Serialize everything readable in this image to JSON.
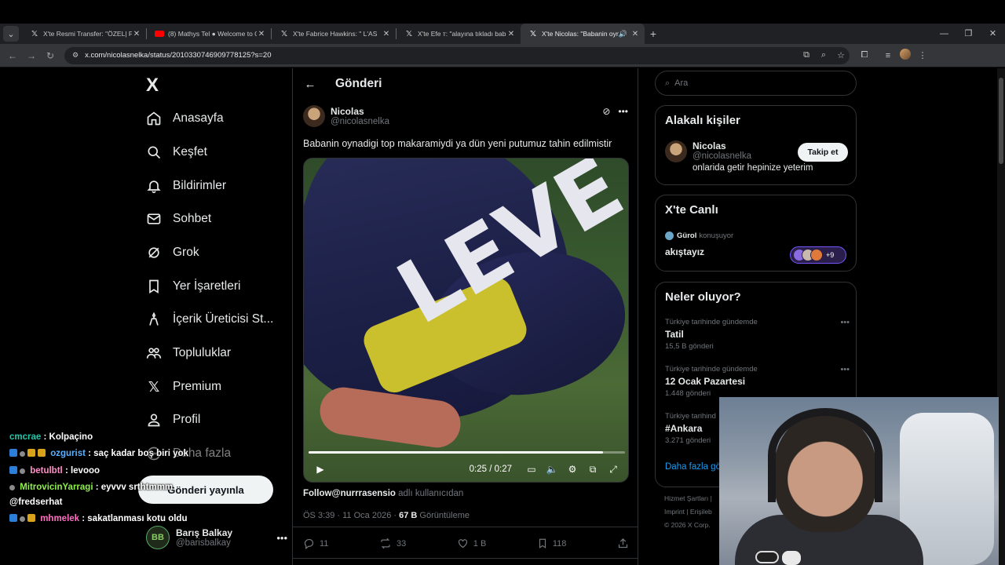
{
  "browser": {
    "tabs": [
      {
        "label": "X'te Resmi Transfer: \"ÖZEL| Fen",
        "favicon": "x-logo",
        "active": false
      },
      {
        "label": "(8) Mathys Tel ● Welcome to G",
        "favicon": "youtube-logo",
        "active": false
      },
      {
        "label": "X'te Fabrice Hawkins: \" L'AS",
        "favicon": "x-logo",
        "active": false
      },
      {
        "label": "X'te Efe т: \"alayına tıkladı bab",
        "favicon": "x-logo",
        "active": false
      },
      {
        "label": "X'te Nicolas: \"Babanin oyna",
        "favicon": "x-logo",
        "active": true
      }
    ],
    "url": "x.com/nicolasnelka/status/2010330746909778125?s=20",
    "window_controls": [
      "—",
      "❐",
      "✕"
    ]
  },
  "nav": {
    "logo": "X",
    "items": [
      {
        "label": "Anasayfa",
        "icon": "home-icon"
      },
      {
        "label": "Keşfet",
        "icon": "search-icon"
      },
      {
        "label": "Bildirimler",
        "icon": "bell-icon"
      },
      {
        "label": "Sohbet",
        "icon": "mail-icon"
      },
      {
        "label": "Grok",
        "icon": "grok-icon"
      },
      {
        "label": "Yer İşaretleri",
        "icon": "bookmark-icon"
      },
      {
        "label": "İçerik Üreticisi St...",
        "icon": "creator-icon"
      },
      {
        "label": "Topluluklar",
        "icon": "communities-icon"
      },
      {
        "label": "Premium",
        "icon": "x-premium-icon"
      },
      {
        "label": "Profil",
        "icon": "profile-icon"
      },
      {
        "label": "Daha fazla",
        "icon": "more-icon"
      }
    ],
    "post_button": "Gönderi yayınla",
    "account": {
      "name": "Barış Balkay",
      "handle": "@barisbalkay",
      "initials": "BB"
    }
  },
  "post": {
    "header_title": "Gönderi",
    "author": {
      "name": "Nicolas",
      "handle": "@nicolasnelka"
    },
    "text": "Babanin oynadigi top makaramiydi ya dün yeni putumuz tahin edilmistir",
    "video": {
      "current": "0:25",
      "total": "0:27",
      "time_display": "0:25 / 0:27",
      "progress": 0.93,
      "jersey_text": "LEVE"
    },
    "source_user": "Follow@nurrrasensio",
    "source_suffix": "adlı kullanıcıdan",
    "time": "ÖS 3:39 · 11 Oca 2026 ·",
    "views_count": "67 B",
    "views_label": "Görüntüleme",
    "stats": {
      "replies": "11",
      "reposts": "33",
      "likes": "1 B",
      "bookmarks": "118"
    }
  },
  "sidebar": {
    "search_placeholder": "Ara",
    "related": {
      "title": "Alakalı kişiler",
      "name": "Nicolas",
      "handle": "@nicolasnelka",
      "bio": "onlarida getir hepinize yeterim",
      "follow_label": "Takip et"
    },
    "live": {
      "title": "X'te Canlı",
      "speaker": "Gürol",
      "speaker_suffix": "konuşuyor",
      "space_title": "akıştayız",
      "extra_count": "+9"
    },
    "trends": {
      "title": "Neler oluyor?",
      "items": [
        {
          "context": "Türkiye tarihinde gündemde",
          "topic": "Tatil",
          "count": "15,5 B gönderi"
        },
        {
          "context": "Türkiye tarihinde gündemde",
          "topic": "12 Ocak Pazartesi",
          "count": "1.448 gönderi"
        },
        {
          "context": "Türkiye tarihind",
          "topic": "#Ankara",
          "count": "3.271 gönderi"
        }
      ],
      "show_more": "Daha fazla gö"
    },
    "footer": {
      "line1": "Hizmet Şartları  |",
      "line2": "Imprint  |  Erişileb",
      "line3": "© 2026 X Corp."
    }
  },
  "chat": [
    {
      "user": "cmcrae",
      "color": "#22c7a9",
      "msg": ": Kolpaçino"
    },
    {
      "user": "ozgurist",
      "color": "#5ab0ff",
      "msg": ": saç kadar boş biri yok"
    },
    {
      "user": "betulbtl",
      "color": "#ff8fc7",
      "msg": ": levooo"
    },
    {
      "user": "MitrovicinYarragi",
      "color": "#8ef04a",
      "msg": ": eyvvv srthtmmm"
    },
    {
      "user": "",
      "color": "#ffffff",
      "msg": "@fredserhat"
    },
    {
      "user": "mhmelek",
      "color": "#ff6fc2",
      "msg": ": sakatlanması kotu oldu"
    }
  ]
}
